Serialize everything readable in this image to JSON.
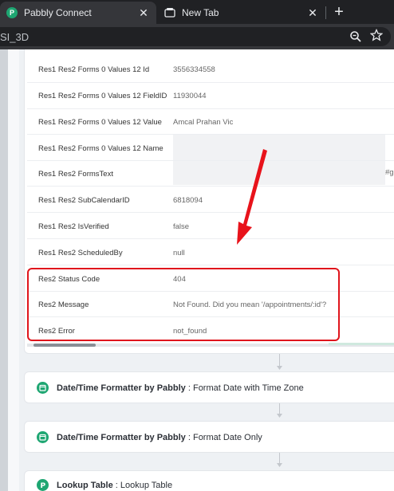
{
  "browser": {
    "tabs": [
      {
        "title": "Pabbly Connect",
        "active": true,
        "icon": "pabbly-icon"
      },
      {
        "title": "New Tab",
        "active": false,
        "icon": "new-tab-icon"
      }
    ],
    "new_tab_symbol": "+",
    "close_symbol": "✕",
    "url_fragment": "SI_3D"
  },
  "response_rows": [
    {
      "key": "Res1 Res2 Forms 0 Values 12 Id",
      "value": "3556334558"
    },
    {
      "key": "Res1 Res2 Forms 0 Values 12 FieldID",
      "value": "11930044"
    },
    {
      "key": "Res1 Res2 Forms 0 Values 12 Value",
      "value": "Amcal Prahan Vic"
    },
    {
      "key": "Res1 Res2 Forms 0 Values 12 Name",
      "value": ""
    },
    {
      "key": "Res1 Res2 FormsText",
      "value": ""
    },
    {
      "key": "Res1 Res2 SubCalendarID",
      "value": "6818094"
    },
    {
      "key": "Res1 Res2 IsVerified",
      "value": "false"
    },
    {
      "key": "Res1 Res2 ScheduledBy",
      "value": "null"
    },
    {
      "key": "Res2 Status Code",
      "value": "404"
    },
    {
      "key": "Res2 Message",
      "value": "Not Found. Did you mean '/appointments/:id'?"
    },
    {
      "key": "Res2 Error",
      "value": "not_found"
    }
  ],
  "forms_text_tail": "#gr",
  "steps": [
    {
      "app": "Date/Time Formatter by Pabbly",
      "separator": " : ",
      "action": "Format Date with Time Zone",
      "icon": "calendar-icon"
    },
    {
      "app": "Date/Time Formatter by Pabbly",
      "separator": " : ",
      "action": "Format Date Only",
      "icon": "calendar-icon"
    },
    {
      "app": "Lookup Table",
      "separator": " : ",
      "action": "Lookup Table",
      "icon": "pabbly-icon"
    }
  ],
  "colors": {
    "highlight": "#e0151c",
    "brand_green": "#1ea672"
  }
}
